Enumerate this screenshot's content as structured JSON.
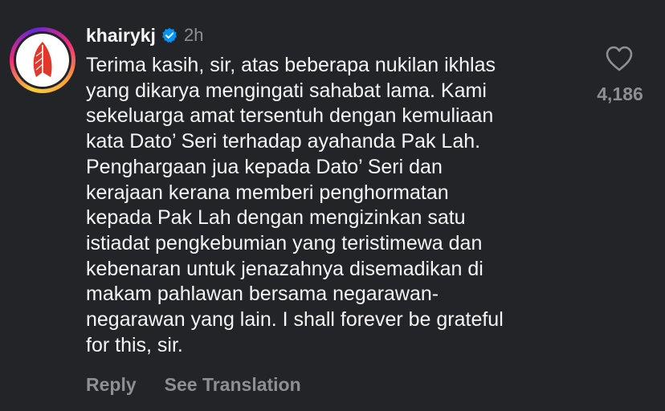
{
  "comment": {
    "username": "khairykj",
    "verified_icon": "verified-badge-icon",
    "time": "2h",
    "text": "Terima kasih, sir, atas beberapa nukilan ikhlas\nyang dikarya mengingati sahabat lama. Kami\nsekeluarga amat tersentuh dengan kemuliaan\nkata Dato’ Seri terhadap ayahanda Pak Lah.\nPenghargaan jua kepada Dato’ Seri dan\nkerajaan kerana memberi penghormatan\nkepada Pak Lah dengan mengizinkan satu\nistiadat pengkebumian yang teristimewa dan\nkebenaran untuk jenazahnya disemadikan di\nmakam pahlawan bersama negarawan-\nnegarawan yang lain. I shall forever be grateful\nfor this, sir.",
    "like_count": "4,186",
    "like_icon": "heart-outline-icon",
    "reply_label": "Reply",
    "translation_label": "See Translation"
  },
  "colors": {
    "background": "#232428",
    "primary_text": "#f5f5f5",
    "secondary_text": "#8e8e93",
    "verified_blue": "#0095f6",
    "avatar_red": "#e2382b"
  }
}
